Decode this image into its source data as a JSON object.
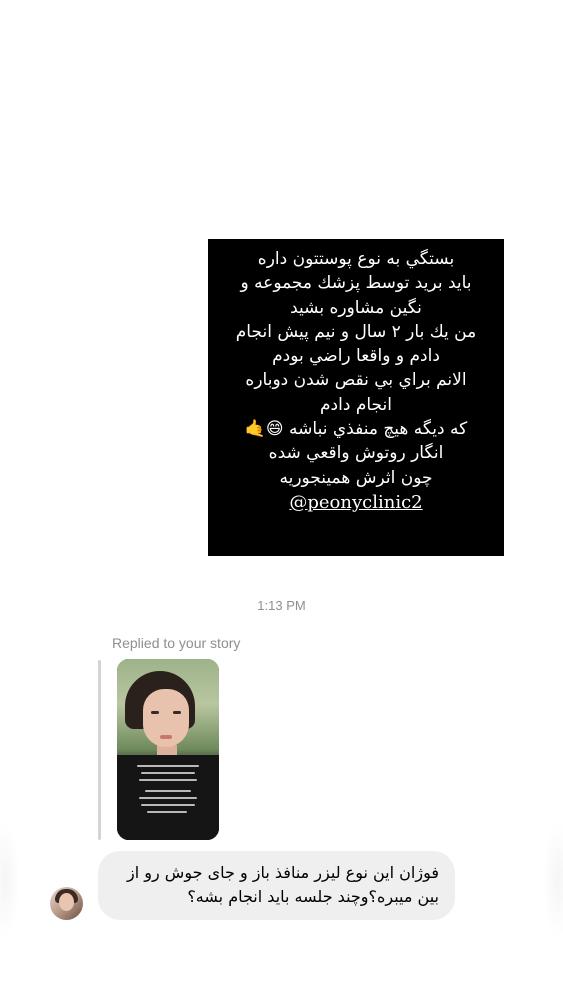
{
  "sent_post": {
    "lines": [
      "بستگي به نوع پوستتون داره",
      "بايد بريد توسط پزشك مجموعه و",
      "نگين مشاوره بشيد",
      "من يك بار ٢ سال و نيم پيش انجام",
      "دادم و واقعا راضي بودم",
      "الانم براي بي نقص شدن دوباره",
      "انجام دادم",
      "که ديگه هيچ منفذي نباشه 😄🤙",
      "انگار روتوش واقعي شده",
      "چون اثرش همينجوريه"
    ],
    "handle": "@peonyclinic2"
  },
  "timestamp": "1:13 PM",
  "reply": {
    "label": "Replied to your story",
    "story_thumbnail": "story-photo-woman"
  },
  "received_message": {
    "lines": [
      "فوژان اين نوع ليزر منافذ باز و جای جوش رو از",
      "بين ميبره؟وچند جلسه بايد انجام بشه؟"
    ],
    "avatar": "user-avatar-photo"
  },
  "colors": {
    "background": "#ffffff",
    "post_background": "#000000",
    "bubble_background": "#efefef",
    "meta_text": "#8e8e93"
  }
}
